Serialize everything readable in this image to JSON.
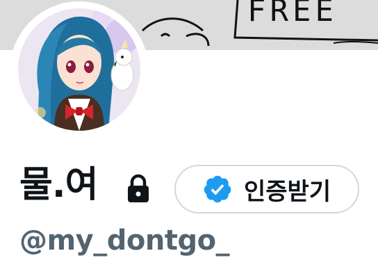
{
  "profile": {
    "banner_text": "FREE",
    "display_name": "물.여",
    "handle": "@my_dontgo_",
    "verify_label": "인증받기",
    "icons": {
      "lock": "lock-icon",
      "verified": "verified-badge-icon"
    }
  },
  "colors": {
    "verified_blue": "#1d9bf0",
    "handle_gray": "#536471",
    "text_dark": "#0f1419",
    "button_border": "#cfd9de"
  }
}
